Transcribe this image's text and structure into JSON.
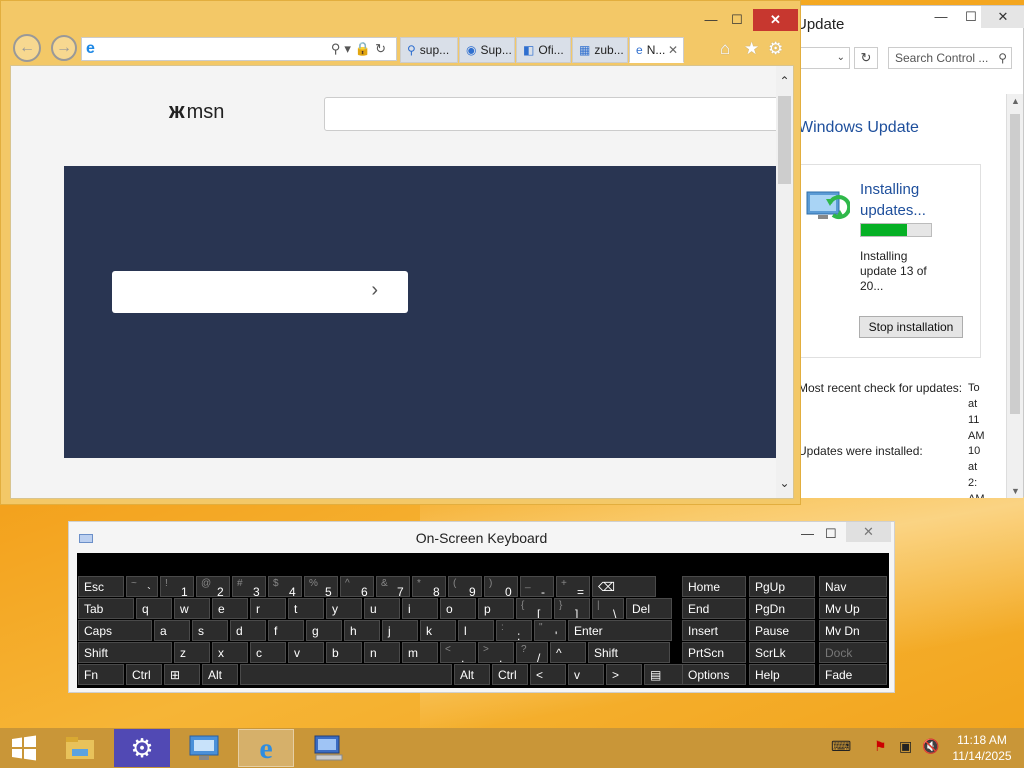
{
  "control_panel": {
    "title": "Update",
    "minimize": "—",
    "maximize": "☐",
    "close": "✕",
    "dropdown_icon": "chevron-down-icon",
    "refresh_icon": "refresh-icon",
    "search_placeholder": "Search Control ...",
    "help": "?",
    "heading": "Windows Update",
    "status_title": "Installing updates...",
    "progress_percent": 65,
    "status_detail": "Installing update 13 of 20...",
    "stop_button": "Stop installation",
    "recent_check_label": "Most recent check for updates:",
    "recent_check_value": "To at 11 AM",
    "installed_label": "Updates were installed:",
    "installed_value": "10 at 2: AM"
  },
  "browser": {
    "back_icon": "back-arrow-icon",
    "forward_icon": "forward-arrow-icon",
    "address_value": "",
    "tabs": [
      {
        "label": "sup...",
        "icon": "search-icon"
      },
      {
        "label": "Sup...",
        "icon": "globe-icon"
      },
      {
        "label": "Ofi...",
        "icon": "office-icon"
      },
      {
        "label": "zub...",
        "icon": "photo-icon"
      },
      {
        "label": "N...",
        "icon": "ie-icon",
        "active": true
      }
    ],
    "home_icon": "home-icon",
    "favorites_icon": "star-icon",
    "settings_icon": "gear-icon",
    "logo_text": "msn",
    "search_value": "",
    "hero_input_value": ""
  },
  "keyboard": {
    "title": "On-Screen Keyboard",
    "rows": [
      [
        {
          "m": "Esc",
          "w": 48
        },
        {
          "s": "~",
          "b": "`",
          "w": 34
        },
        {
          "s": "!",
          "b": "1",
          "w": 36
        },
        {
          "s": "@",
          "b": "2",
          "w": 36
        },
        {
          "s": "#",
          "b": "3",
          "w": 36
        },
        {
          "s": "$",
          "b": "4",
          "w": 36
        },
        {
          "s": "%",
          "b": "5",
          "w": 36
        },
        {
          "s": "^",
          "b": "6",
          "w": 36
        },
        {
          "s": "&",
          "b": "7",
          "w": 36
        },
        {
          "s": "*",
          "b": "8",
          "w": 36
        },
        {
          "s": "(",
          "b": "9",
          "w": 36
        },
        {
          "s": ")",
          "b": "0",
          "w": 36
        },
        {
          "s": "_",
          "b": "-",
          "w": 36
        },
        {
          "s": "+",
          "b": "=",
          "w": 36
        },
        {
          "m": "⌫",
          "w": 66
        }
      ],
      [
        {
          "m": "Tab",
          "w": 58
        },
        {
          "m": "q",
          "w": 38
        },
        {
          "m": "w",
          "w": 38
        },
        {
          "m": "e",
          "w": 38
        },
        {
          "m": "r",
          "w": 38
        },
        {
          "m": "t",
          "w": 38
        },
        {
          "m": "y",
          "w": 38
        },
        {
          "m": "u",
          "w": 38
        },
        {
          "m": "i",
          "w": 38
        },
        {
          "m": "o",
          "w": 38
        },
        {
          "m": "p",
          "w": 38
        },
        {
          "s": "{",
          "b": "[",
          "w": 38
        },
        {
          "s": "}",
          "b": "]",
          "w": 38
        },
        {
          "s": "|",
          "b": "\\",
          "w": 34
        },
        {
          "m": "Del",
          "w": 48
        }
      ],
      [
        {
          "m": "Caps",
          "w": 76
        },
        {
          "m": "a",
          "w": 38
        },
        {
          "m": "s",
          "w": 38
        },
        {
          "m": "d",
          "w": 38
        },
        {
          "m": "f",
          "w": 38
        },
        {
          "m": "g",
          "w": 38
        },
        {
          "m": "h",
          "w": 38
        },
        {
          "m": "j",
          "w": 38
        },
        {
          "m": "k",
          "w": 38
        },
        {
          "m": "l",
          "w": 38
        },
        {
          "s": ":",
          "b": ";",
          "w": 38
        },
        {
          "s": "\"",
          "b": "'",
          "w": 34
        },
        {
          "m": "Enter",
          "w": 106
        }
      ],
      [
        {
          "m": "Shift",
          "w": 96
        },
        {
          "m": "z",
          "w": 38
        },
        {
          "m": "x",
          "w": 38
        },
        {
          "m": "c",
          "w": 38
        },
        {
          "m": "v",
          "w": 38
        },
        {
          "m": "b",
          "w": 38
        },
        {
          "m": "n",
          "w": 38
        },
        {
          "m": "m",
          "w": 38
        },
        {
          "s": "<",
          "b": ",",
          "w": 38
        },
        {
          "s": ">",
          "b": ".",
          "w": 38
        },
        {
          "s": "?",
          "b": "/",
          "w": 34
        },
        {
          "m": "^",
          "w": 38
        },
        {
          "m": "Shift",
          "w": 84
        }
      ],
      [
        {
          "m": "Fn",
          "w": 48
        },
        {
          "m": "Ctrl",
          "w": 38
        },
        {
          "m": "⊞",
          "w": 38
        },
        {
          "m": "Alt",
          "w": 38
        },
        {
          "m": "",
          "w": 214
        },
        {
          "m": "Alt",
          "w": 38
        },
        {
          "m": "Ctrl",
          "w": 38
        },
        {
          "m": "<",
          "w": 38
        },
        {
          "m": "v",
          "w": 38
        },
        {
          "m": ">",
          "w": 38
        },
        {
          "m": "▤",
          "w": 48
        }
      ]
    ],
    "nav_keys": [
      [
        "Home",
        "PgUp",
        "Nav"
      ],
      [
        "End",
        "PgDn",
        "Mv Up"
      ],
      [
        "Insert",
        "Pause",
        "Mv Dn"
      ],
      [
        "PrtScn",
        "ScrLk",
        "Dock"
      ],
      [
        "Options",
        "Help",
        "Fade"
      ]
    ],
    "minimize": "—",
    "restore": "☐",
    "close": "✕"
  },
  "taskbar": {
    "items": [
      "windows-start-icon",
      "file-explorer-icon",
      "control-panel-icon",
      "remote-desktop-icon",
      "internet-explorer-icon",
      "computer-icon"
    ],
    "time": "11:18 AM",
    "date": "11/14/2025"
  }
}
